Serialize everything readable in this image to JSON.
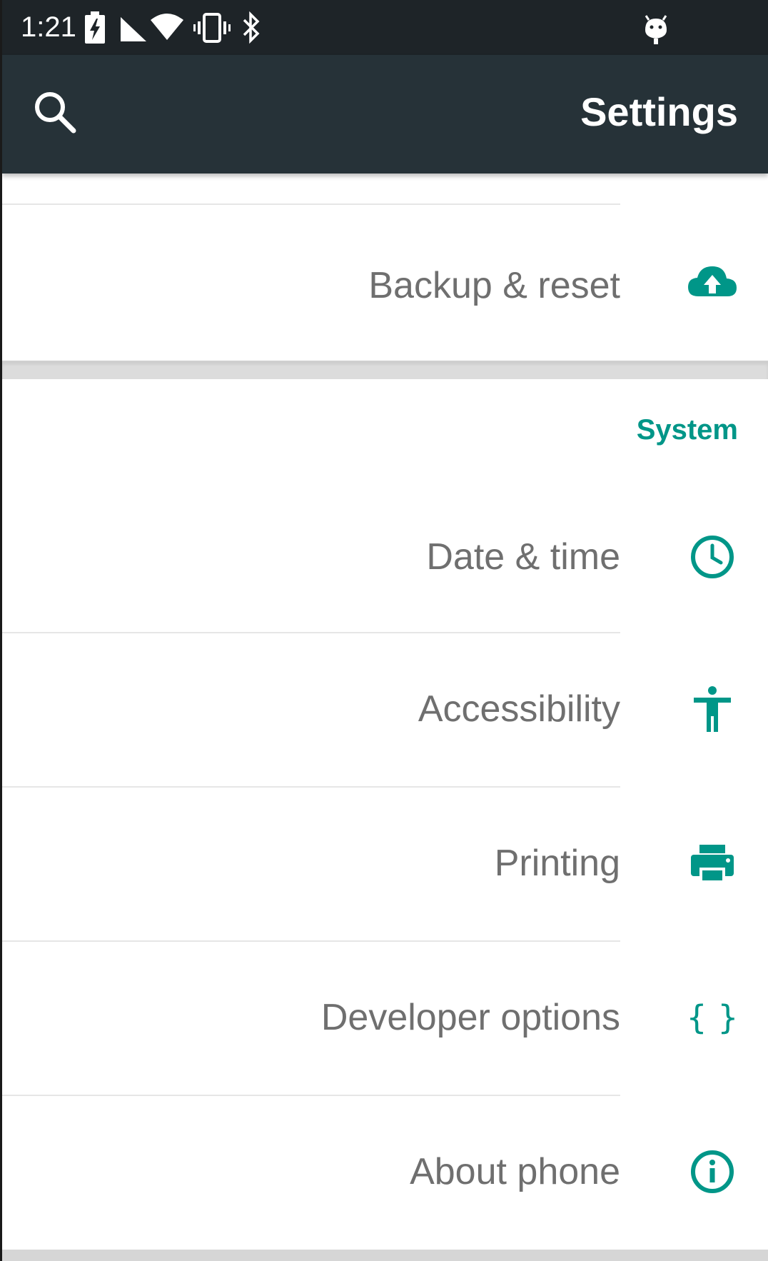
{
  "status_bar": {
    "time": "1:21",
    "icons": [
      "battery-charging-icon",
      "signal-icon",
      "wifi-icon",
      "vibrate-icon",
      "bluetooth-icon",
      "android-debug-icon"
    ]
  },
  "app_bar": {
    "title": "Settings",
    "search_icon": "search-icon"
  },
  "colors": {
    "accent": "#009688",
    "app_bar": "#263238",
    "status_bar": "#1e2428",
    "item_text": "#6f6f6f"
  },
  "list": {
    "top_items": [
      {
        "label": "Backup & reset",
        "icon": "cloud-upload-icon"
      }
    ],
    "section_header": "System",
    "system_items": [
      {
        "label": "Date & time",
        "icon": "clock-icon"
      },
      {
        "label": "Accessibility",
        "icon": "accessibility-icon"
      },
      {
        "label": "Printing",
        "icon": "printer-icon"
      },
      {
        "label": "Developer options",
        "icon": "braces-icon"
      },
      {
        "label": "About phone",
        "icon": "info-icon"
      }
    ]
  }
}
